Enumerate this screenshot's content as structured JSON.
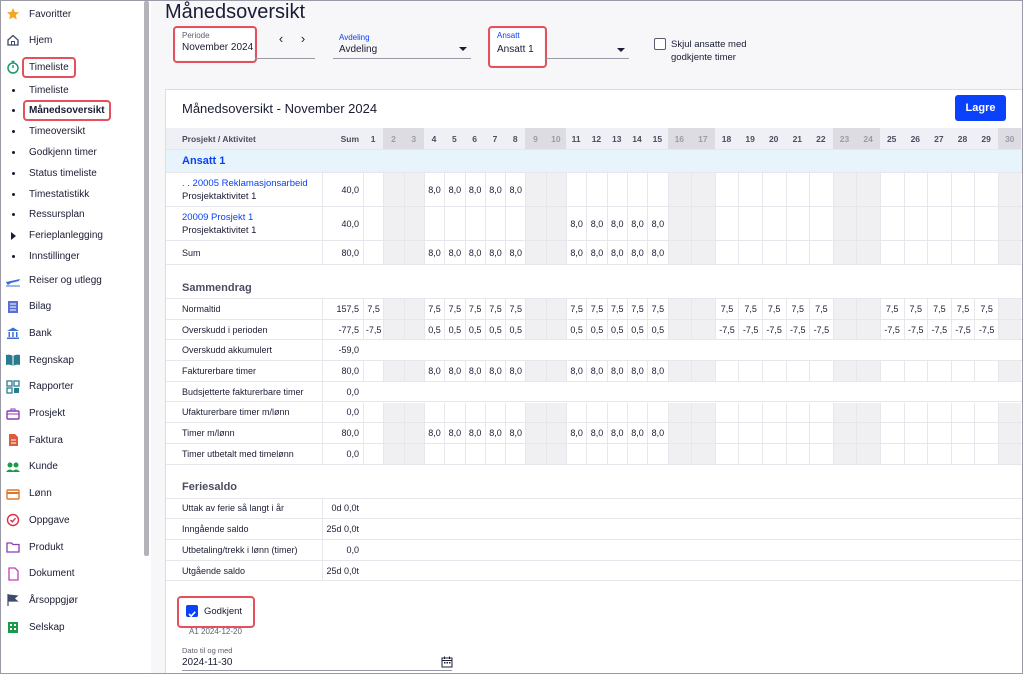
{
  "sidebar": {
    "top_items": [
      {
        "label": "Favoritter",
        "icon": "star-icon"
      },
      {
        "label": "Hjem",
        "icon": "home-icon"
      },
      {
        "label": "Timeliste",
        "icon": "stopwatch-icon"
      }
    ],
    "sub_items": [
      {
        "label": "Timeliste",
        "marker": "bullet"
      },
      {
        "label": "Månedsoversikt",
        "marker": "bullet"
      },
      {
        "label": "Timeoversikt",
        "marker": "bullet"
      },
      {
        "label": "Godkjenn timer",
        "marker": "bullet"
      },
      {
        "label": "Status timeliste",
        "marker": "bullet"
      },
      {
        "label": "Timestatistikk",
        "marker": "bullet"
      },
      {
        "label": "Ressursplan",
        "marker": "bullet"
      },
      {
        "label": "Ferieplanlegging",
        "marker": "triangle"
      },
      {
        "label": "Innstillinger",
        "marker": "bullet"
      }
    ],
    "bottom_items": [
      {
        "label": "Reiser og utlegg",
        "icon": "airplane-icon"
      },
      {
        "label": "Bilag",
        "icon": "document-lines-icon"
      },
      {
        "label": "Bank",
        "icon": "bank-icon"
      },
      {
        "label": "Regnskap",
        "icon": "book-icon"
      },
      {
        "label": "Rapporter",
        "icon": "grid-icon"
      },
      {
        "label": "Prosjekt",
        "icon": "briefcase-icon"
      },
      {
        "label": "Faktura",
        "icon": "invoice-icon"
      },
      {
        "label": "Kunde",
        "icon": "people-icon"
      },
      {
        "label": "Lønn",
        "icon": "wallet-icon"
      },
      {
        "label": "Oppgave",
        "icon": "check-circle-icon"
      },
      {
        "label": "Produkt",
        "icon": "folder-icon"
      },
      {
        "label": "Dokument",
        "icon": "file-icon"
      },
      {
        "label": "Årsoppgjør",
        "icon": "flag-icon"
      },
      {
        "label": "Selskap",
        "icon": "building-icon"
      }
    ]
  },
  "header": {
    "title": "Månedsoversikt",
    "periode": {
      "label": "Periode",
      "value": "November 2024"
    },
    "prev_arrow": "‹",
    "next_arrow": "›",
    "avdeling": {
      "label": "Avdeling",
      "value": "Avdeling"
    },
    "ansatt": {
      "label": "Ansatt",
      "value": "Ansatt 1"
    },
    "hide_approved": "Skjul ansatte med godkjente timer"
  },
  "card": {
    "title": "Månedsoversikt - November 2024",
    "save_label": "Lagre"
  },
  "table": {
    "col_project": "Prosjekt / Aktivitet",
    "col_sum": "Sum",
    "days": [
      "1",
      "2",
      "3",
      "4",
      "5",
      "6",
      "7",
      "8",
      "9",
      "10",
      "11",
      "12",
      "13",
      "14",
      "15",
      "16",
      "17",
      "18",
      "19",
      "20",
      "21",
      "22",
      "23",
      "24",
      "25",
      "26",
      "27",
      "28",
      "29",
      "30"
    ],
    "weekend_days": [
      2,
      3,
      9,
      10,
      16,
      17,
      23,
      24,
      30
    ],
    "employee": "Ansatt 1",
    "projects": [
      {
        "name": ". . 20005 Reklamasjonsarbeid",
        "activity": "Prosjektaktivitet 1",
        "sum": "40,0",
        "values": {
          "4": "8,0",
          "5": "8,0",
          "6": "8,0",
          "7": "8,0",
          "8": "8,0"
        }
      },
      {
        "name": "20009 Prosjekt 1",
        "activity": "Prosjektaktivitet 1",
        "sum": "40,0",
        "values": {
          "11": "8,0",
          "12": "8,0",
          "13": "8,0",
          "14": "8,0",
          "15": "8,0"
        }
      }
    ],
    "sum_row": {
      "label": "Sum",
      "sum": "80,0",
      "values": {
        "4": "8,0",
        "5": "8,0",
        "6": "8,0",
        "7": "8,0",
        "8": "8,0",
        "11": "8,0",
        "12": "8,0",
        "13": "8,0",
        "14": "8,0",
        "15": "8,0"
      }
    },
    "summary_title": "Sammendrag",
    "summary_rows": [
      {
        "label": "Normaltid",
        "sum": "157,5",
        "values": {
          "1": "7,5",
          "4": "7,5",
          "5": "7,5",
          "6": "7,5",
          "7": "7,5",
          "8": "7,5",
          "11": "7,5",
          "12": "7,5",
          "13": "7,5",
          "14": "7,5",
          "15": "7,5",
          "18": "7,5",
          "19": "7,5",
          "20": "7,5",
          "21": "7,5",
          "22": "7,5",
          "25": "7,5",
          "26": "7,5",
          "27": "7,5",
          "28": "7,5",
          "29": "7,5"
        }
      },
      {
        "label": "Overskudd i perioden",
        "sum": "-77,5",
        "values": {
          "1": "-7,5",
          "4": "0,5",
          "5": "0,5",
          "6": "0,5",
          "7": "0,5",
          "8": "0,5",
          "11": "0,5",
          "12": "0,5",
          "13": "0,5",
          "14": "0,5",
          "15": "0,5",
          "18": "-7,5",
          "19": "-7,5",
          "20": "-7,5",
          "21": "-7,5",
          "22": "-7,5",
          "25": "-7,5",
          "26": "-7,5",
          "27": "-7,5",
          "28": "-7,5",
          "29": "-7,5"
        }
      },
      {
        "label": "Overskudd akkumulert",
        "sum": "-59,0",
        "values": {},
        "no_days": true
      },
      {
        "label": "Fakturerbare timer",
        "sum": "80,0",
        "values": {
          "4": "8,0",
          "5": "8,0",
          "6": "8,0",
          "7": "8,0",
          "8": "8,0",
          "11": "8,0",
          "12": "8,0",
          "13": "8,0",
          "14": "8,0",
          "15": "8,0"
        }
      },
      {
        "label": "Budsjetterte fakturerbare timer",
        "sum": "0,0",
        "values": {},
        "no_days": true
      },
      {
        "label": "Ufakturerbare timer m/lønn",
        "sum": "0,0",
        "values": {}
      },
      {
        "label": "Timer m/lønn",
        "sum": "80,0",
        "values": {
          "4": "8,0",
          "5": "8,0",
          "6": "8,0",
          "7": "8,0",
          "8": "8,0",
          "11": "8,0",
          "12": "8,0",
          "13": "8,0",
          "14": "8,0",
          "15": "8,0"
        }
      },
      {
        "label": "Timer utbetalt med timelønn",
        "sum": "0,0",
        "values": {}
      }
    ],
    "vacation_title": "Feriesaldo",
    "vacation_rows": [
      {
        "label": "Uttak av ferie så langt i år",
        "sum": "0d 0,0t"
      },
      {
        "label": "Inngående saldo",
        "sum": "25d 0,0t"
      },
      {
        "label": "Utbetaling/trekk i lønn (timer)",
        "sum": "0,0"
      },
      {
        "label": "Utgående saldo",
        "sum": "25d 0,0t"
      }
    ]
  },
  "approval": {
    "label": "Godkjent",
    "meta": "A1 2024-12-20",
    "date_label": "Dato til og med",
    "date_value": "2024-11-30"
  },
  "colors": {
    "accent": "#0a41fa",
    "highlight": "#e4505c",
    "weekend": "#f0f0f2",
    "employee_row": "#e8f4fb"
  }
}
